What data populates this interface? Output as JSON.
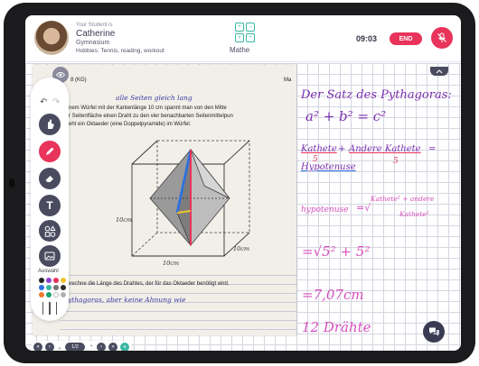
{
  "header": {
    "student_kicker": "Your Student is",
    "student_name": "Catherine",
    "school": "Gymnasium",
    "hobbies": "Hobbies: Tennis, reading, workout",
    "subject": "Mathe",
    "math_symbols": [
      "+",
      "−",
      "×",
      "÷"
    ],
    "timer": "09:03",
    "end_label": "END"
  },
  "worksheet": {
    "header_text": "8 (KG)",
    "header_right": "Ma",
    "task1_line1": "nem Würfel mit der Kantenlänge 10 cm spannt man von den Mitte",
    "task1_line2": "r Seitenfläche einen Draht zu den vier benachbarten Seitenmittelpun",
    "task1_line3": "eht ein Oktaeder (eine Doppelpyramide) im Würfel.",
    "note_top": "alle Seiten gleich lang",
    "label_left": "10cm",
    "label_bottom": "10cm",
    "label_right": "10cm",
    "task2": "Berechne die Länge des Drahtes, der für das Oktaeder benötigt wird.",
    "note_bottom": "Pythagoras, aber keine Ahnung wie"
  },
  "handwriting": {
    "title": "Der Satz des Pythagoras:",
    "formula": "a² + b² = c²",
    "word_kathete1": "Kathete",
    "plus": "+",
    "word_kathete2": "Andere Kathete",
    "eq": "=",
    "word_hypotenuse": "Hypotenuse",
    "num5a": "5",
    "num5b": "5",
    "pink_hypotenuse": "hypotenuse",
    "pink_eq": "=√",
    "pink_frac_top": "Kathete² + andere",
    "pink_frac_bottom": "Kathete²",
    "root_expr": "=√5² + 5²",
    "result": "=7,07cm",
    "count": "12 Drähte"
  },
  "toolbar": {
    "auswahl": "Auswahl",
    "colors": [
      "#222222",
      "#8a3fd1",
      "#e8335a",
      "#f2c230",
      "#2e6fe0",
      "#3bb6a4",
      "#777777",
      "#2b2b2b",
      "#f07a2a",
      "#1aa36f",
      "#ffffff",
      "#b0b0b0"
    ]
  },
  "pager": {
    "label": "1/2"
  },
  "colors": {
    "accent_red": "#e8335a",
    "accent_teal": "#3bb6a4",
    "ink_purple": "#7a2fb0",
    "ink_pink": "#d64fbf",
    "ink_blue": "#2a6fe0"
  }
}
